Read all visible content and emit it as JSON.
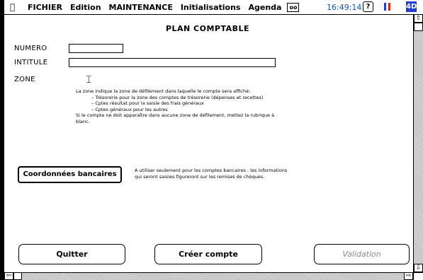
{
  "menubar": {
    "items": [
      "FICHIER",
      "Edition",
      "MAINTENANCE",
      "Initialisations",
      "Agenda"
    ],
    "tape_label": "oo",
    "clock": "16:49:14",
    "help_glyph": "?",
    "app_badge": "4D"
  },
  "form": {
    "title": "PLAN COMPTABLE",
    "numero_label": "NUMERO",
    "numero_value": "",
    "intitule_label": "INTITULE",
    "intitule_value": "",
    "zone_label": "ZONE",
    "zone_help": {
      "line1": "La zone indique la zone de défilement dans laquelle le compte sera affiché:",
      "line2": "– Trésorerie pour la zone des comptes de trésorerie (dépenses et recettes)",
      "line3": "– Cptes résultat pour la saisie des frais généraux",
      "line4": "– Cptes généraux pour les autres",
      "line5": "Si le compte ne doit apparaître dans aucune zone de défilement, mettez la rubrique à",
      "line6": "blanc."
    },
    "bank_button": "Coordonnées bancaires",
    "bank_note": {
      "line1": "A utiliser seulement pour les comptes bancaires : les informations",
      "line2": "qui seront saisies figureront sur les remises de chèques."
    }
  },
  "buttons": {
    "quit": "Quitter",
    "create": "Créer compte",
    "validate": "Validation"
  },
  "colors": {
    "clock": "#0b57c4",
    "app_badge": "#1f3fd0",
    "flag": [
      "#1f3fd0",
      "#ffffff",
      "#e0201b"
    ]
  }
}
